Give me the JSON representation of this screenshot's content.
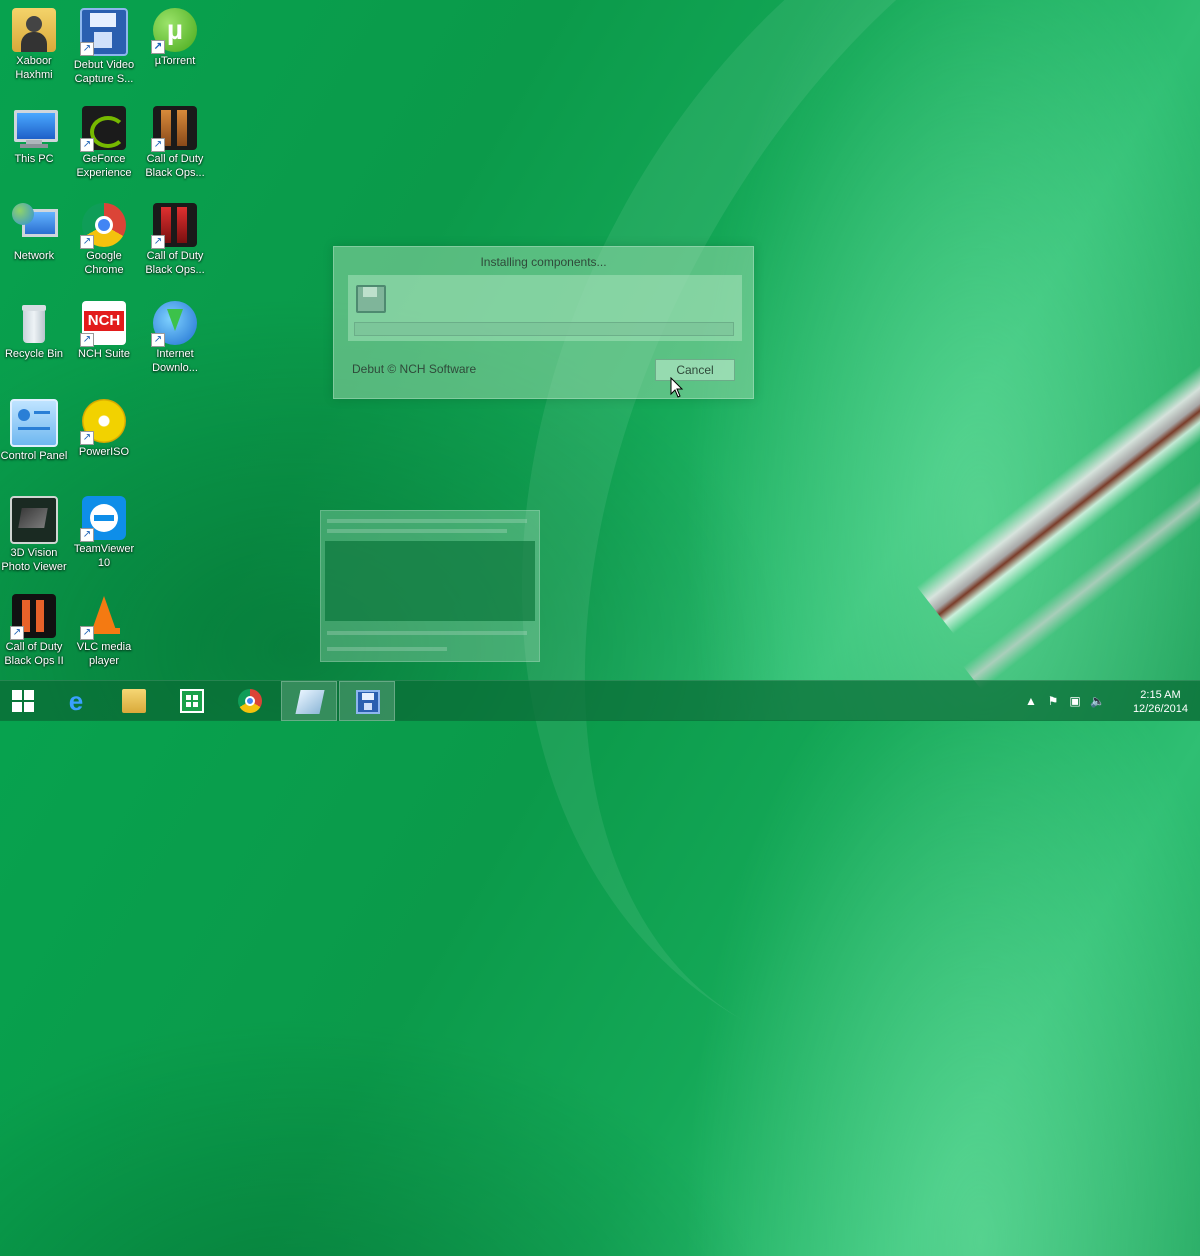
{
  "desktop": {
    "icons": [
      {
        "label": "Xaboor Haxhmi"
      },
      {
        "label": "Debut Video Capture S..."
      },
      {
        "label": "µTorrent"
      },
      {
        "label": "This PC"
      },
      {
        "label": "GeForce Experience"
      },
      {
        "label": "Call of Duty Black Ops..."
      },
      {
        "label": "Network"
      },
      {
        "label": "Google Chrome"
      },
      {
        "label": "Call of Duty Black Ops..."
      },
      {
        "label": "Recycle Bin"
      },
      {
        "label": "NCH Suite"
      },
      {
        "label": "Internet Downlo..."
      },
      {
        "label": "Control Panel"
      },
      {
        "label": "PowerISO"
      },
      {
        "label": "3D Vision Photo Viewer"
      },
      {
        "label": "TeamViewer 10"
      },
      {
        "label": "Call of Duty Black Ops II"
      },
      {
        "label": "VLC media player"
      }
    ]
  },
  "dialog": {
    "title": "Installing components...",
    "footer": "Debut © NCH Software",
    "cancel_label": "Cancel",
    "progress": 0
  },
  "taskbar": {
    "apps": [
      {
        "icon": "internet-explorer-icon"
      },
      {
        "icon": "file-explorer-icon"
      },
      {
        "icon": "store-icon"
      },
      {
        "icon": "chrome-icon"
      },
      {
        "icon": "installer-icon"
      },
      {
        "icon": "debut-icon"
      }
    ],
    "clock_time": "2:15 AM",
    "clock_date": "12/26/2014"
  }
}
